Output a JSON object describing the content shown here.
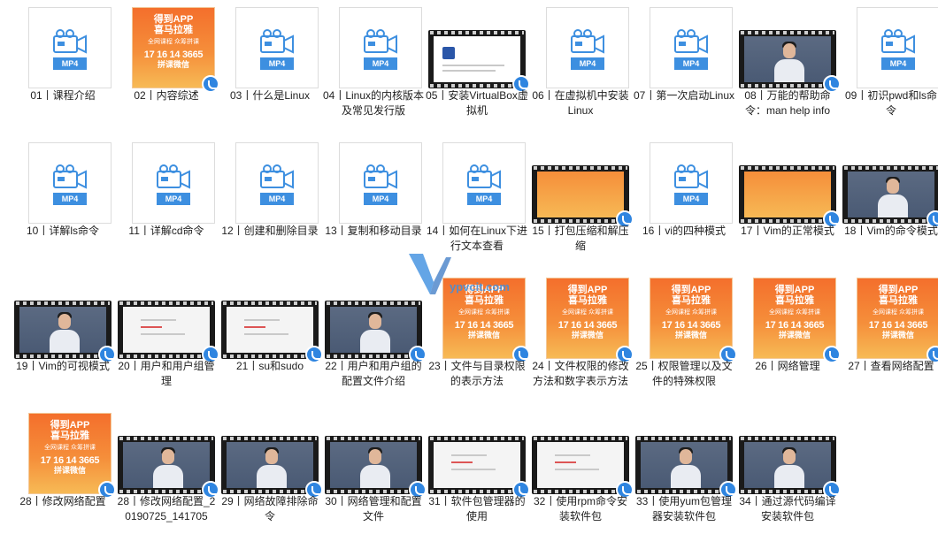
{
  "watermark": {
    "text": "ypvcit.com"
  },
  "poster": {
    "line1": "得到APP",
    "line2": "喜马拉雅",
    "line3": "全网课程 众筹拼课",
    "line4": "17 16 14 3665",
    "line5": "拼课微信"
  },
  "file_badge": "MP4",
  "items": [
    {
      "label": "01丨课程介绍",
      "type": "file"
    },
    {
      "label": "02丨内容综述",
      "type": "poster"
    },
    {
      "label": "03丨什么是Linux",
      "type": "file"
    },
    {
      "label": "04丨Linux的内核版本及常见发行版",
      "type": "file"
    },
    {
      "label": "05丨安装VirtualBox虚拟机",
      "type": "vbox"
    },
    {
      "label": "06丨在虚拟机中安装Linux",
      "type": "file"
    },
    {
      "label": "07丨第一次启动Linux",
      "type": "file"
    },
    {
      "label": "08丨万能的帮助命令：man help info",
      "type": "person"
    },
    {
      "label": "09丨初识pwd和ls命令",
      "type": "file"
    },
    {
      "label": "10丨详解ls命令",
      "type": "file"
    },
    {
      "label": "11丨详解cd命令",
      "type": "file"
    },
    {
      "label": "12丨创建和删除目录",
      "type": "file"
    },
    {
      "label": "13丨复制和移动目录",
      "type": "file"
    },
    {
      "label": "14丨如何在Linux下进行文本查看",
      "type": "file"
    },
    {
      "label": "15丨打包压缩和解压缩",
      "type": "orange"
    },
    {
      "label": "16丨vi的四种模式",
      "type": "file"
    },
    {
      "label": "17丨Vim的正常模式",
      "type": "orange"
    },
    {
      "label": "18丨Vim的命令模式",
      "type": "person"
    },
    {
      "label": "19丨Vim的可视模式",
      "type": "person"
    },
    {
      "label": "20丨用户和用户组管理",
      "type": "slide"
    },
    {
      "label": "21丨su和sudo",
      "type": "slide"
    },
    {
      "label": "22丨用户和用户组的配置文件介绍",
      "type": "person"
    },
    {
      "label": "23丨文件与目录权限的表示方法",
      "type": "poster"
    },
    {
      "label": "24丨文件权限的修改方法和数字表示方法",
      "type": "poster"
    },
    {
      "label": "25丨权限管理以及文件的特殊权限",
      "type": "poster"
    },
    {
      "label": "26丨网络管理",
      "type": "poster"
    },
    {
      "label": "27丨查看网络配置",
      "type": "poster"
    },
    {
      "label": "28丨修改网络配置",
      "type": "poster"
    },
    {
      "label": "28丨修改网络配置_20190725_141705",
      "type": "person"
    },
    {
      "label": "29丨网络故障排除命令",
      "type": "person"
    },
    {
      "label": "30丨网络管理和配置文件",
      "type": "person"
    },
    {
      "label": "31丨软件包管理器的使用",
      "type": "slide"
    },
    {
      "label": "32丨使用rpm命令安装软件包",
      "type": "slide"
    },
    {
      "label": "33丨使用yum包管理器安装软件包",
      "type": "person"
    },
    {
      "label": "34丨通过源代码编译安装软件包",
      "type": "person"
    }
  ]
}
